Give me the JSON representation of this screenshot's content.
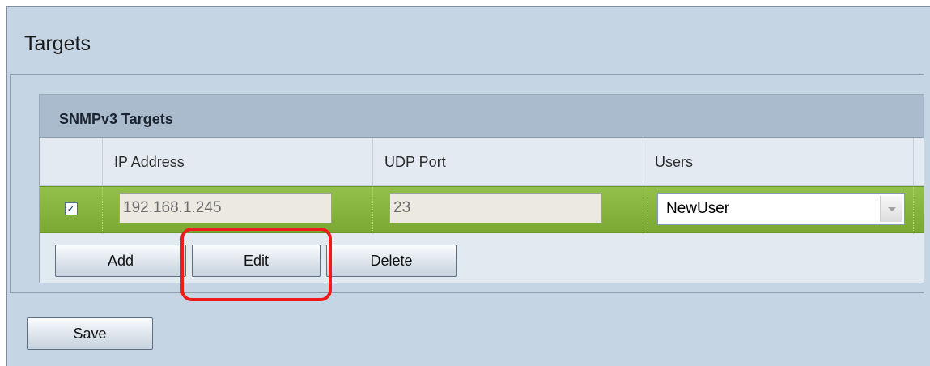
{
  "page": {
    "title": "Targets"
  },
  "snmp_targets": {
    "section_title": "SNMPv3 Targets",
    "columns": [
      "",
      "IP Address",
      "UDP Port",
      "Users"
    ],
    "rows": [
      {
        "checked": true,
        "check_glyph": "✓",
        "ip_address": "192.168.1.245",
        "udp_port": "23",
        "user": "NewUser"
      }
    ],
    "buttons": {
      "add": "Add",
      "edit": "Edit",
      "delete": "Delete"
    }
  },
  "footer": {
    "save_label": "Save"
  },
  "colors": {
    "page_background": "#c6d5e4",
    "section_header": "#aabbcd",
    "selected_row": "#86b43e",
    "highlight_annotation": "#ee1c1c"
  }
}
